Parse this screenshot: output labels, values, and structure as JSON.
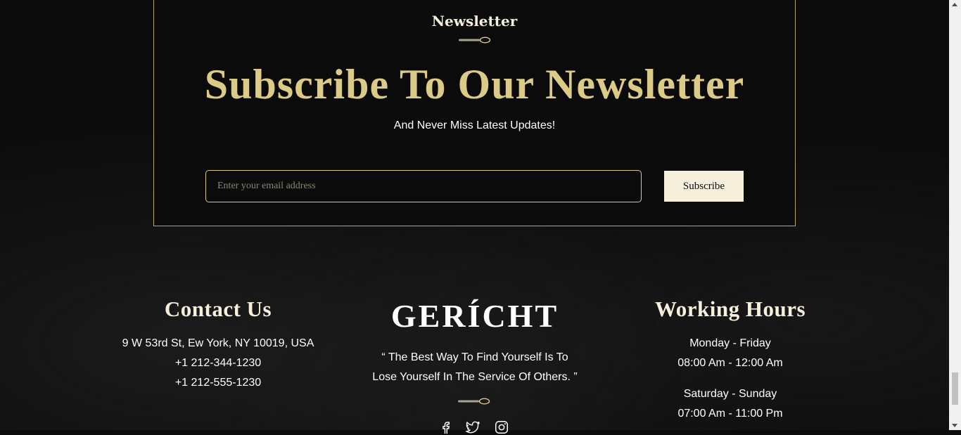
{
  "newsletter": {
    "tag": "Newsletter",
    "title": "Subscribe To Our Newsletter",
    "subtitle": "And Never Miss Latest Updates!",
    "email_placeholder": "Enter your email address",
    "subscribe_label": "Subscribe"
  },
  "footer": {
    "contact": {
      "heading": "Contact Us",
      "address": "9 W 53rd St, Ew York, NY 10019, USA",
      "phone1": "+1 212-344-1230",
      "phone2": "+1 212-555-1230"
    },
    "brand": {
      "logo": "GERÍCHT",
      "quote_line1": "“ The Best Way To Find Yourself Is To",
      "quote_line2": "Lose Yourself In The Service Of Others. ”",
      "socials": [
        "facebook-icon",
        "twitter-icon",
        "instagram-icon"
      ]
    },
    "hours": {
      "heading": "Working Hours",
      "weekday_label": "Monday - Friday",
      "weekday_time": "08:00 Am - 12:00 Am",
      "weekend_label": "Saturday - Sunday",
      "weekend_time": "07:00 Am - 11:00 Pm"
    }
  },
  "colors": {
    "background": "#0c0c0c",
    "gold": "#dcca87",
    "cream": "#f5efdb",
    "white": "#ffffff"
  }
}
